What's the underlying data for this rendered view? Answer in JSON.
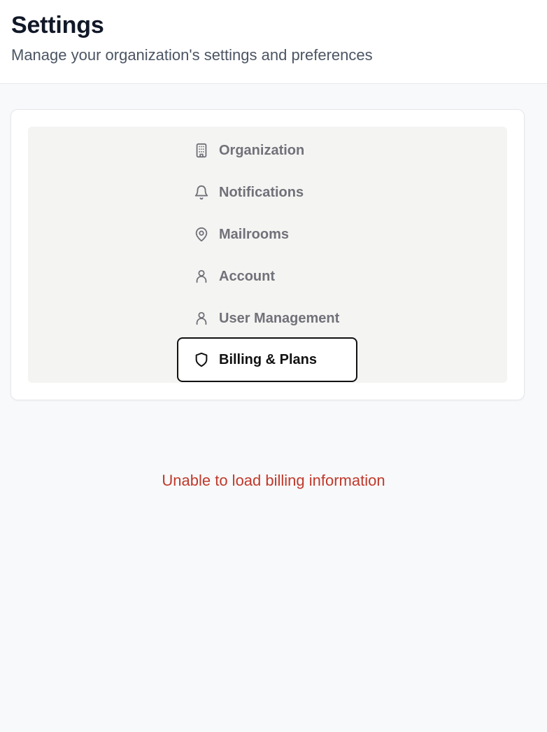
{
  "header": {
    "title": "Settings",
    "subtitle": "Manage your organization's settings and preferences"
  },
  "nav": {
    "items": [
      {
        "label": "Organization",
        "icon": "building-icon",
        "active": false
      },
      {
        "label": "Notifications",
        "icon": "bell-icon",
        "active": false
      },
      {
        "label": "Mailrooms",
        "icon": "map-pin-icon",
        "active": false
      },
      {
        "label": "Account",
        "icon": "user-icon",
        "active": false
      },
      {
        "label": "User Management",
        "icon": "user-icon",
        "active": false
      },
      {
        "label": "Billing & Plans",
        "icon": "shield-icon",
        "active": true
      }
    ]
  },
  "status": {
    "error_message": "Unable to load billing information"
  },
  "colors": {
    "error": "#c0392b",
    "active_border": "#111111",
    "nav_text": "#71717a",
    "nav_bg": "#f4f4f2"
  }
}
